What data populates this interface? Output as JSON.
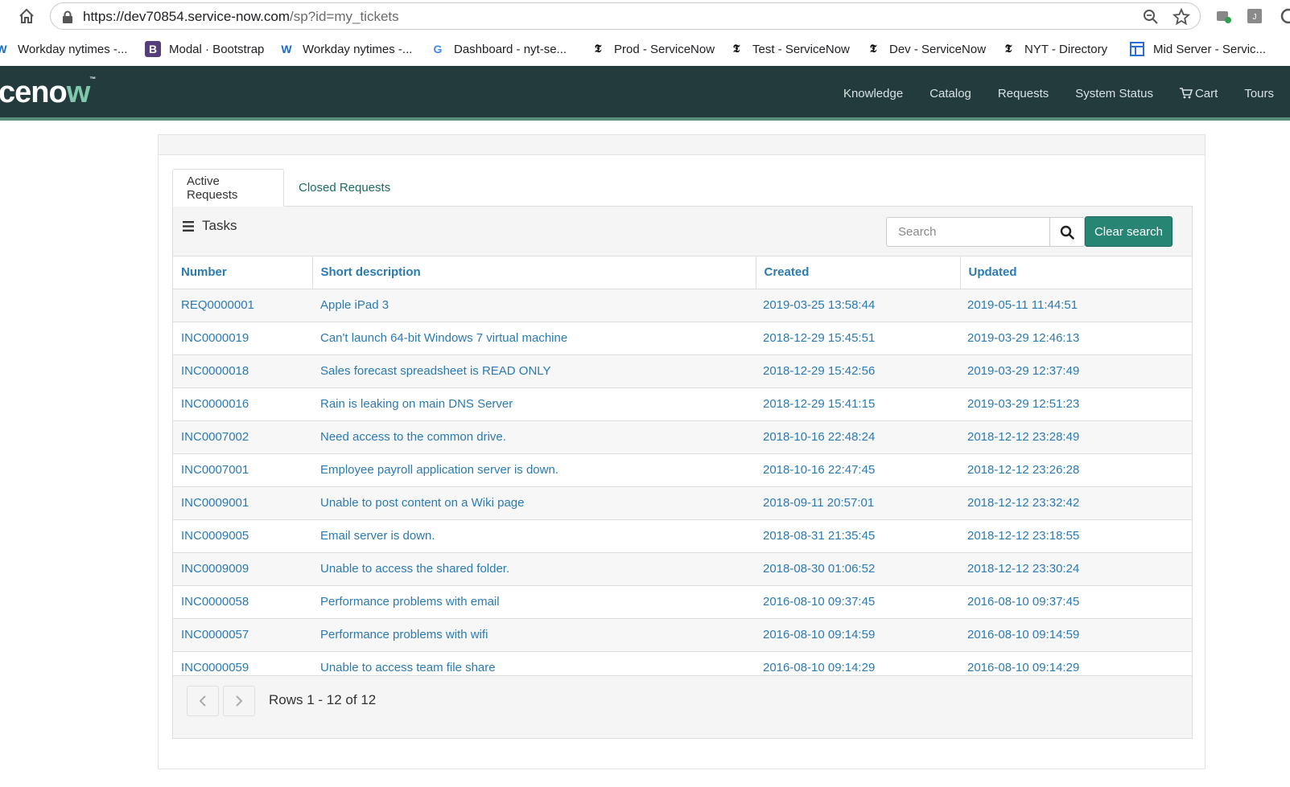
{
  "browser": {
    "url_main": "https://dev70854.service-now.com",
    "url_path": "/sp?id=my_tickets",
    "bookmarks": [
      {
        "label": "Workday nytimes -...",
        "icon": "workday-icon"
      },
      {
        "label": "Modal · Bootstrap",
        "icon": "bootstrap-icon"
      },
      {
        "label": "Workday nytimes -...",
        "icon": "workday-icon"
      },
      {
        "label": "Dashboard - nyt-se...",
        "icon": "google-icon"
      },
      {
        "label": "Prod - ServiceNow",
        "icon": "nyt-icon"
      },
      {
        "label": "Test - ServiceNow",
        "icon": "nyt-icon"
      },
      {
        "label": "Dev - ServiceNow",
        "icon": "nyt-icon"
      },
      {
        "label": "NYT - Directory",
        "icon": "nyt-icon"
      },
      {
        "label": "Mid Server - Servic...",
        "icon": "table-icon"
      }
    ]
  },
  "header": {
    "logo": "cenow",
    "nav": [
      "Knowledge",
      "Catalog",
      "Requests",
      "System Status",
      "Cart",
      "Tours"
    ],
    "bg_color": "#243b3e"
  },
  "tabs": {
    "active": "Active Requests",
    "inactive": "Closed Requests"
  },
  "tasks": {
    "title": "Tasks",
    "search_placeholder": "Search",
    "clear_label": "Clear search",
    "columns": [
      "Number",
      "Short description",
      "Created",
      "Updated"
    ],
    "rows": [
      [
        "REQ0000001",
        "Apple iPad 3",
        "2019-03-25 13:58:44",
        "2019-05-11 11:44:51"
      ],
      [
        "INC0000019",
        "Can't launch 64-bit Windows 7 virtual machine",
        "2018-12-29 15:45:51",
        "2019-03-29 12:46:13"
      ],
      [
        "INC0000018",
        "Sales forecast spreadsheet is READ ONLY",
        "2018-12-29 15:42:56",
        "2019-03-29 12:37:49"
      ],
      [
        "INC0000016",
        "Rain is leaking on main DNS Server",
        "2018-12-29 15:41:15",
        "2019-03-29 12:51:23"
      ],
      [
        "INC0007002",
        "Need access to the common drive.",
        "2018-10-16 22:48:24",
        "2018-12-12 23:28:49"
      ],
      [
        "INC0007001",
        "Employee payroll application server is down.",
        "2018-10-16 22:47:45",
        "2018-12-12 23:26:28"
      ],
      [
        "INC0009001",
        "Unable to post content on a Wiki page",
        "2018-09-11 20:57:01",
        "2018-12-12 23:32:42"
      ],
      [
        "INC0009005",
        "Email server is down.",
        "2018-08-31 21:35:45",
        "2018-12-12 23:18:55"
      ],
      [
        "INC0009009",
        "Unable to access the shared folder.",
        "2018-08-30 01:06:52",
        "2018-12-12 23:30:24"
      ],
      [
        "INC0000058",
        "Performance problems with email",
        "2016-08-10 09:37:45",
        "2016-08-10 09:37:45"
      ],
      [
        "INC0000057",
        "Performance problems with wifi",
        "2016-08-10 09:14:59",
        "2016-08-10 09:14:59"
      ],
      [
        "INC0000059",
        "Unable to access team file share",
        "2016-08-10 09:14:29",
        "2016-08-10 09:14:29"
      ]
    ],
    "rows_info": "Rows 1 - 12 of 12",
    "accent_color": "#278574",
    "link_color": "#2a7ab3"
  }
}
